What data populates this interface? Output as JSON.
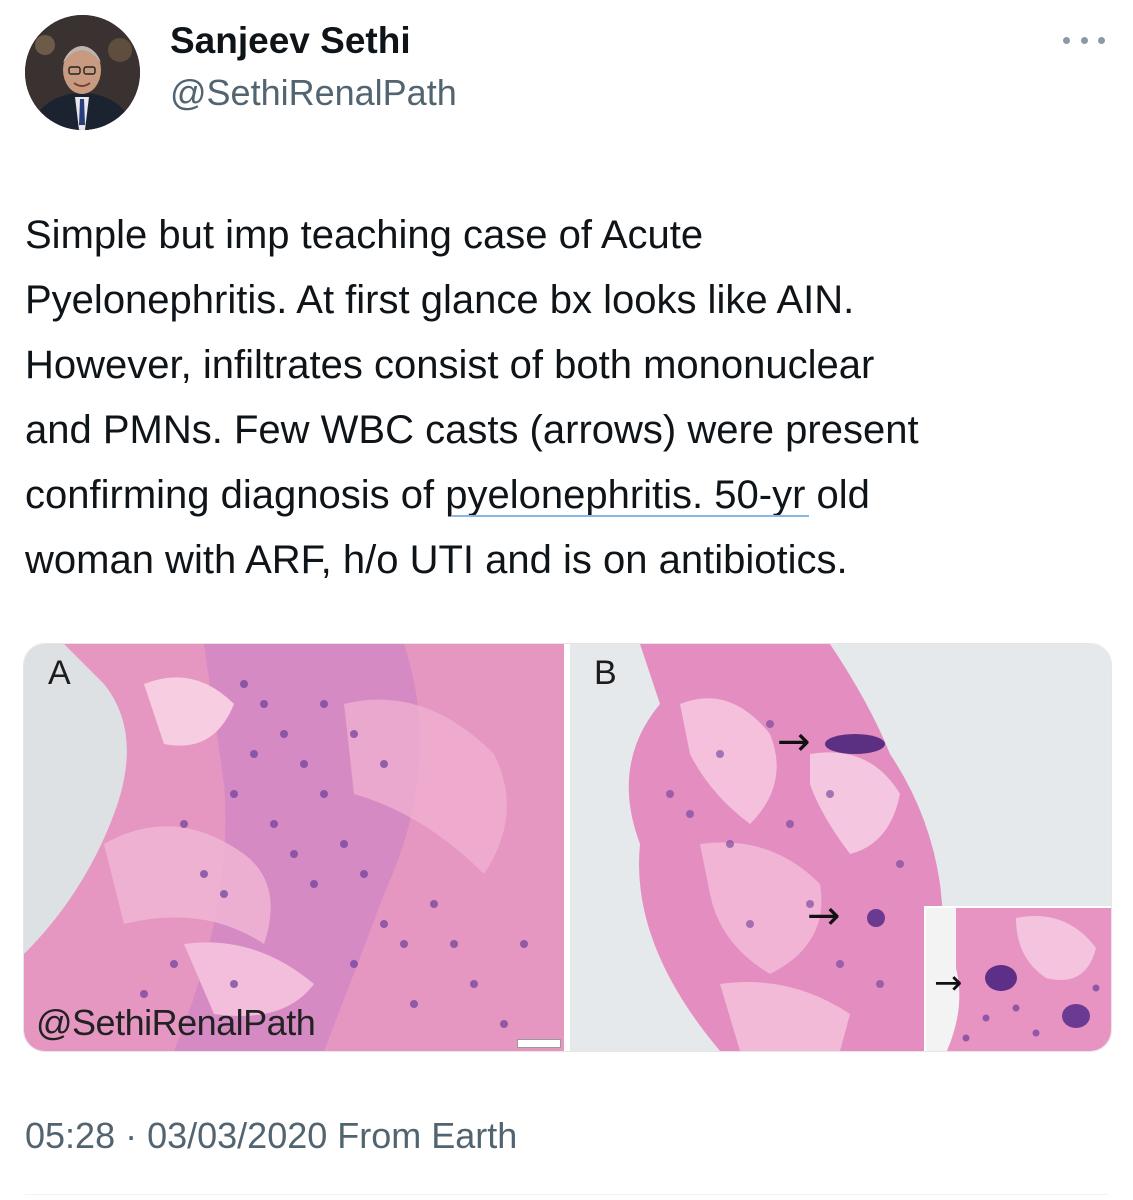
{
  "author": {
    "display_name": "Sanjeev Sethi",
    "handle": "@SethiRenalPath"
  },
  "tweet": {
    "text": "Simple but imp teaching case of Acute\nPyelonephritis. At first glance bx looks like AIN.\nHowever, infiltrates consist of both mononuclear\nand PMNs. Few WBC casts (arrows) were present\nconfirming diagnosis of pyelonephritis. 50-yr old\nwoman with ARF, h/o UTI and is on antibiotics.",
    "timestamp": "05:28 · 03/03/2020 From Earth"
  },
  "media": {
    "panel_a_label": "A",
    "panel_b_label": "B",
    "watermark": "@SethiRenalPath"
  },
  "icons": {
    "more": "more-dots-icon",
    "arrow": "right-arrow"
  },
  "colors": {
    "text_primary": "#0f1419",
    "text_secondary": "#536471",
    "tissue_pink": "#e58cbb",
    "nuclei_purple": "#5b3a8c"
  }
}
